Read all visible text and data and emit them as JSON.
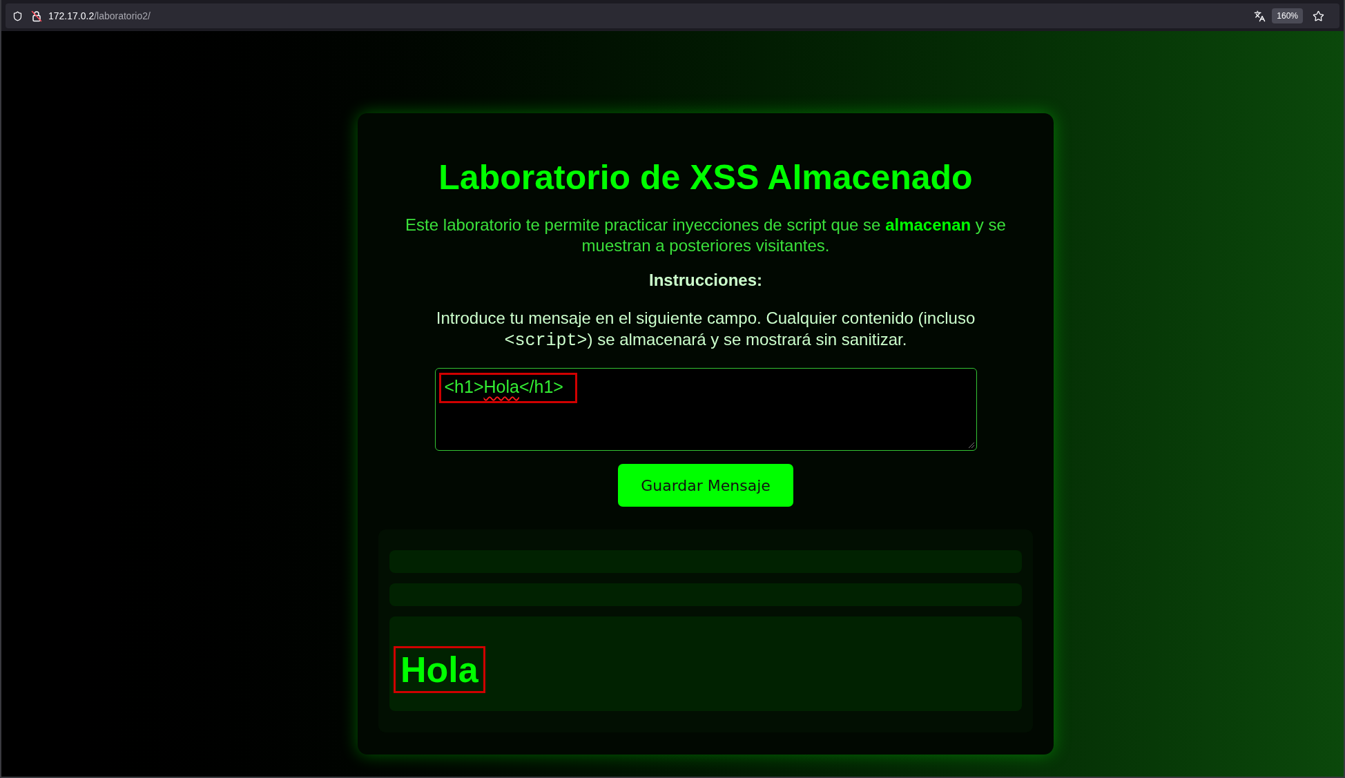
{
  "browser": {
    "address_bar": {
      "host": "172.17.0.2",
      "path": "/laboratorio2/"
    },
    "zoom_level": "160%"
  },
  "page": {
    "title": "Laboratorio de XSS Almacenado",
    "intro": "Este laboratorio te permite practicar inyecciones de script que se **almacenan** y se muestran a posteriores visitantes.",
    "instructions_heading": "Instrucciones:",
    "instructions": {
      "before": "Introduce tu mensaje en el siguiente campo. Cualquier contenido (incluso ",
      "code": "<script>",
      "after": ") se almacenará y se mostrará sin sanitizar."
    },
    "message_field": {
      "value": [
        {
          "text": "<h1>",
          "misspelled": false
        },
        {
          "text": "Hola",
          "misspelled": true
        },
        {
          "text": "</h1>",
          "misspelled": false
        }
      ],
      "highlighted": true
    },
    "save_button": "Guardar Mensaje",
    "messages": [
      {
        "kind": "empty"
      },
      {
        "kind": "empty"
      },
      {
        "kind": "heading",
        "text": "Hola",
        "highlighted": true
      }
    ]
  }
}
